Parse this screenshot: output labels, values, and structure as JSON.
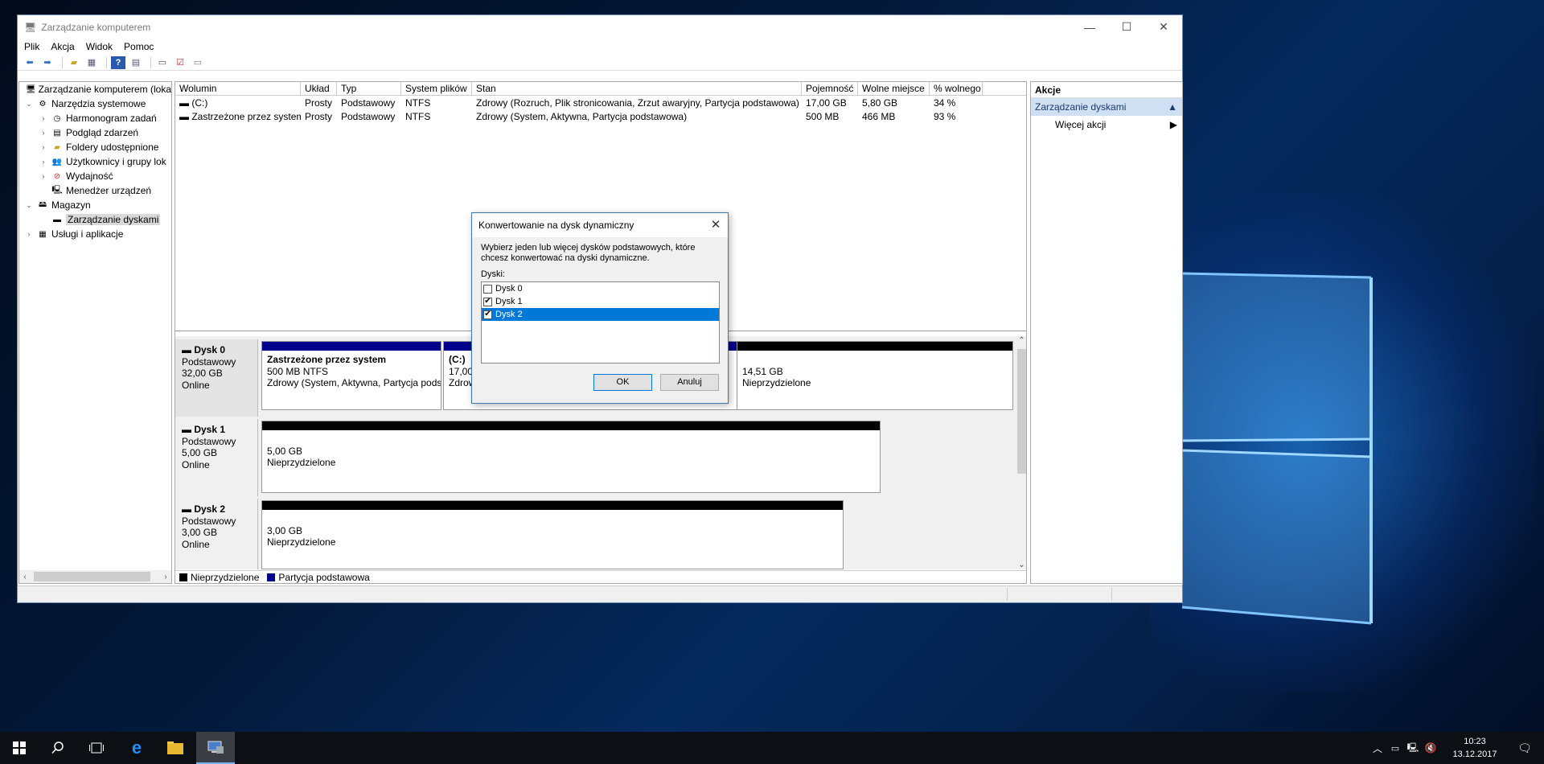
{
  "window": {
    "title": "Zarządzanie komputerem",
    "icons": {
      "minimize": "minimize-icon",
      "maximize": "maximize-icon",
      "close": "close-icon"
    }
  },
  "menu": [
    "Plik",
    "Akcja",
    "Widok",
    "Pomoc"
  ],
  "toolbar": {
    "icons": [
      "back-arrow-icon",
      "forward-arrow-icon",
      "up-folder-icon",
      "show-hide-tree-icon",
      "help-icon",
      "properties-icon",
      "connect-icon",
      "check-icon",
      "list-icon"
    ]
  },
  "tree": {
    "root": "Zarządzanie komputerem (loka",
    "system_tools": "Narzędzia systemowe",
    "task_scheduler": "Harmonogram zadań",
    "event_viewer": "Podgląd zdarzeń",
    "shared_folders": "Foldery udostępnione",
    "users": "Użytkownicy i grupy lok",
    "performance": "Wydajność",
    "device_manager": "Menedżer urządzeń",
    "storage": "Magazyn",
    "disk_mgmt": "Zarządzanie dyskami",
    "services": "Usługi i aplikacje"
  },
  "volumes": {
    "headers": [
      "Wolumin",
      "Układ",
      "Typ",
      "System plików",
      "Stan",
      "Pojemność",
      "Wolne miejsce",
      "% wolnego"
    ],
    "rows": [
      [
        "(C:)",
        "Prosty",
        "Podstawowy",
        "NTFS",
        "Zdrowy (Rozruch, Plik stronicowania, Zrzut awaryjny, Partycja podstawowa)",
        "17,00 GB",
        "5,80 GB",
        "34 %"
      ],
      [
        "Zastrzeżone przez system",
        "Prosty",
        "Podstawowy",
        "NTFS",
        "Zdrowy (System, Aktywna, Partycja podstawowa)",
        "500 MB",
        "466 MB",
        "93 %"
      ]
    ]
  },
  "disks": [
    {
      "name": "Dysk 0",
      "type": "Podstawowy",
      "size": "32,00 GB",
      "status": "Online",
      "p1_name": "Zastrzeżone przez system",
      "p1_size": "500 MB NTFS",
      "p1_state": "Zdrowy (System, Aktywna, Partycja pods",
      "p2_name": "(C:)",
      "p2_size": "17,00",
      "p2_state": "Zdrow",
      "p3_size": "14,51 GB",
      "p3_state": "Nieprzydzielone"
    },
    {
      "name": "Dysk 1",
      "type": "Podstawowy",
      "size": "5,00 GB",
      "status": "Online",
      "p_size": "5,00 GB",
      "p_state": "Nieprzydzielone"
    },
    {
      "name": "Dysk 2",
      "type": "Podstawowy",
      "size": "3,00 GB",
      "status": "Online",
      "p_size": "3,00 GB",
      "p_state": "Nieprzydzielone"
    }
  ],
  "legend": {
    "unallocated": "Nieprzydzielone",
    "primary": "Partycja podstawowa",
    "colors": {
      "unallocated": "#000000",
      "primary": "#00008b"
    }
  },
  "actions": {
    "header": "Akcje",
    "section": "Zarządzanie dyskami",
    "more": "Więcej akcji"
  },
  "dialog": {
    "title": "Konwertowanie na dysk dynamiczny",
    "message": "Wybierz jeden lub więcej dysków podstawowych, które chcesz konwertować na dyski dynamiczne.",
    "list_label": "Dyski:",
    "items": [
      {
        "label": "Dysk 0",
        "checked": false
      },
      {
        "label": "Dysk 1",
        "checked": true
      },
      {
        "label": "Dysk 2",
        "checked": true,
        "selected": true
      }
    ],
    "ok": "OK",
    "cancel": "Anuluj"
  },
  "taskbar": {
    "icons": [
      "windows-start-icon",
      "search-icon",
      "task-view-icon",
      "edge-icon",
      "file-explorer-icon",
      "computer-management-icon"
    ],
    "time": "10:23",
    "date": "13.12.2017"
  }
}
